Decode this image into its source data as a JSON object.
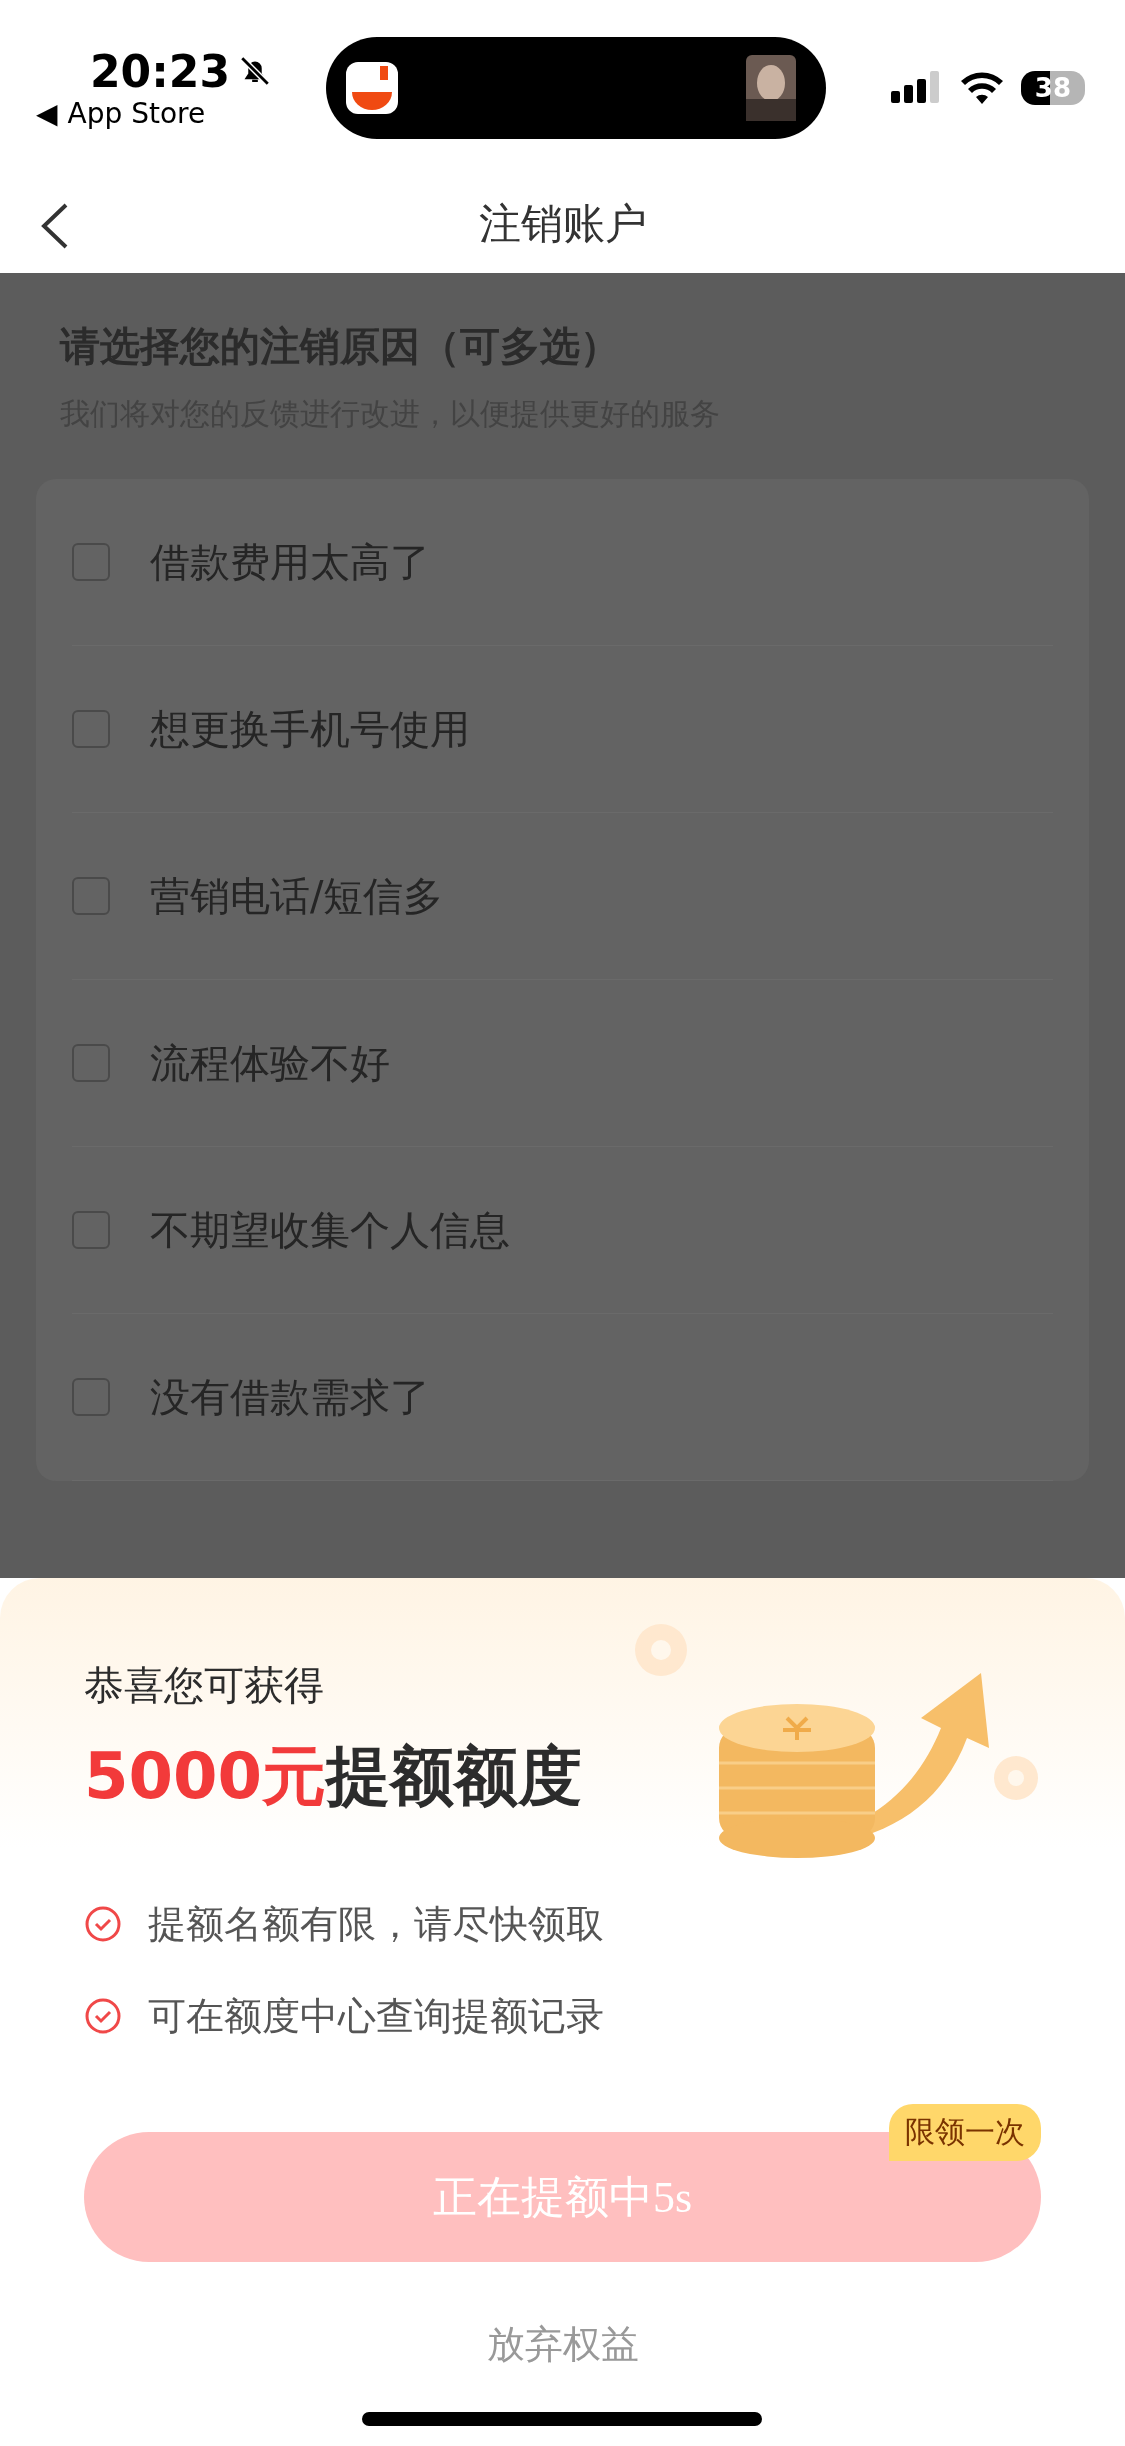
{
  "status_bar": {
    "time": "20:23",
    "back_glyph": "◀",
    "back_label": "App Store",
    "battery": "38"
  },
  "nav": {
    "title": "注销账户"
  },
  "form": {
    "heading": "请选择您的注销原因（可多选）",
    "subtitle": "我们将对您的反馈进行改进，以便提供更好的服务",
    "reasons": [
      {
        "label": "借款费用太高了",
        "checked": false
      },
      {
        "label": "想更换手机号使用",
        "checked": false
      },
      {
        "label": "营销电话/短信多",
        "checked": false
      },
      {
        "label": "流程体验不好",
        "checked": false
      },
      {
        "label": "不期望收集个人信息",
        "checked": false
      },
      {
        "label": "没有借款需求了",
        "checked": false
      }
    ]
  },
  "sheet": {
    "title": "恭喜您可获得",
    "amount": "5000元",
    "amount_suffix": "提额额度",
    "benefits": [
      "提额名额有限，请尽快领取",
      "可在额度中心查询提额记录"
    ],
    "button": {
      "label": "正在提额中5s",
      "disabled": true
    },
    "badge": "限领一次",
    "dismiss": "放弃权益"
  }
}
